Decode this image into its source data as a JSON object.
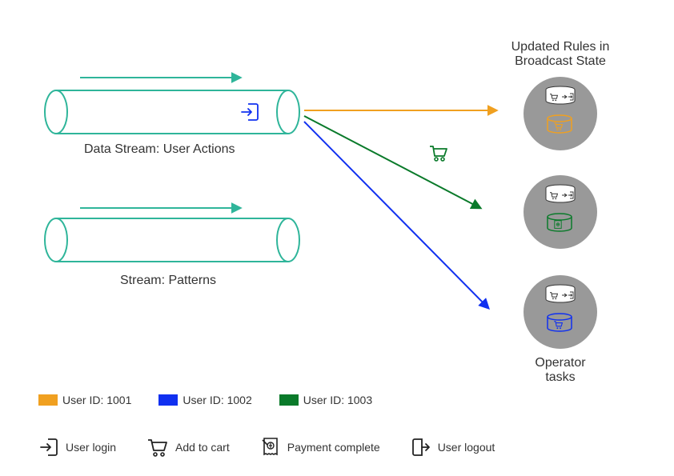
{
  "header": {
    "updated_rules": "Updated Rules in\nBroadcast State"
  },
  "streams": {
    "data_stream_label": "Data Stream: User Actions",
    "pattern_stream_label": "Stream: Patterns",
    "operator_tasks_label": "Operator\ntasks"
  },
  "colors": {
    "user1001": "#f0a020",
    "user1002": "#1030f0",
    "user1003": "#0a7a2a",
    "teal": "#2fb59a",
    "gray": "#999999"
  },
  "legend_users": [
    {
      "id": "user-1001",
      "label": "User ID: 1001",
      "color_key": "user1001"
    },
    {
      "id": "user-1002",
      "label": "User ID: 1002",
      "color_key": "user1002"
    },
    {
      "id": "user-1003",
      "label": "User ID: 1003",
      "color_key": "user1003"
    }
  ],
  "legend_icons": [
    {
      "id": "user-login",
      "label": "User login",
      "icon": "login"
    },
    {
      "id": "add-to-cart",
      "label": "Add to cart",
      "icon": "cart"
    },
    {
      "id": "payment-complete",
      "label": "Payment complete",
      "icon": "receipt"
    },
    {
      "id": "user-logout",
      "label": "User logout",
      "icon": "logout"
    }
  ],
  "diagram": {
    "tasks": [
      {
        "id": "task-1",
        "db_color_key": "user1001"
      },
      {
        "id": "task-2",
        "db_color_key": "user1003"
      },
      {
        "id": "task-3",
        "db_color_key": "user1002"
      }
    ]
  }
}
